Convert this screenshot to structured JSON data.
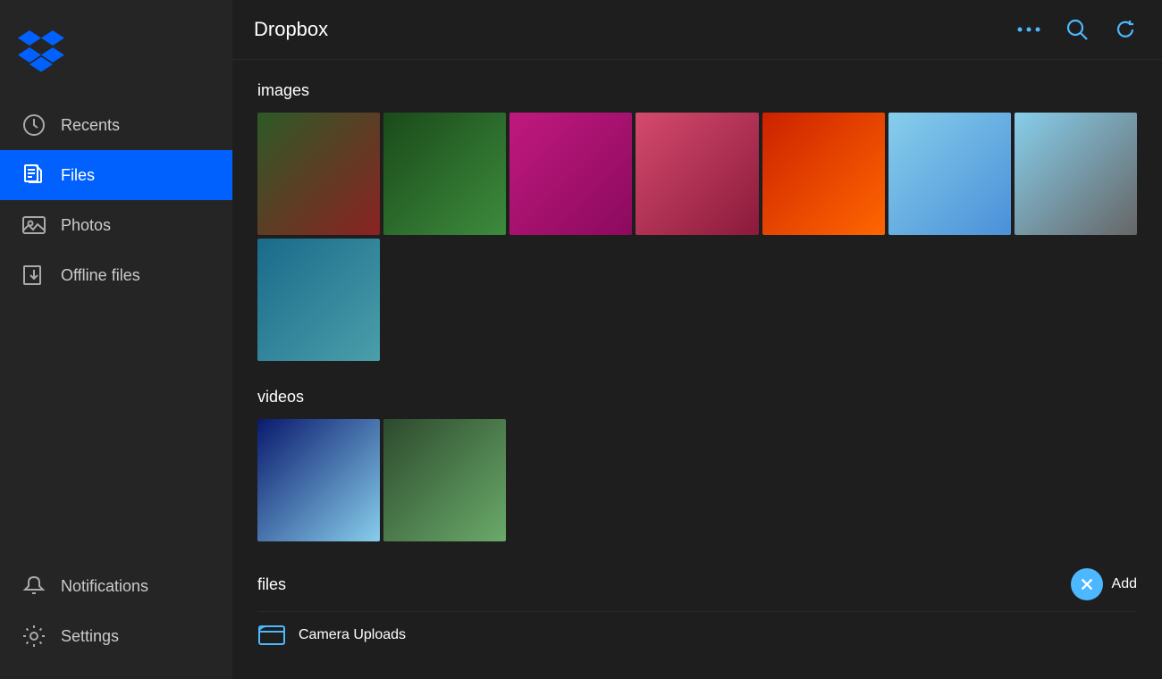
{
  "app": {
    "title": "Dropbox"
  },
  "sidebar": {
    "items": [
      {
        "id": "recents",
        "label": "Recents",
        "active": false
      },
      {
        "id": "files",
        "label": "Files",
        "active": true
      },
      {
        "id": "photos",
        "label": "Photos",
        "active": false
      },
      {
        "id": "offline",
        "label": "Offline files",
        "active": false
      }
    ],
    "bottom_items": [
      {
        "id": "notifications",
        "label": "Notifications"
      },
      {
        "id": "settings",
        "label": "Settings"
      }
    ]
  },
  "main": {
    "header": "Dropbox",
    "sections": [
      {
        "id": "images",
        "title": "images"
      },
      {
        "id": "videos",
        "title": "videos"
      },
      {
        "id": "files",
        "title": "files"
      }
    ],
    "add_button_label": "Add",
    "add_icon": "✕",
    "file_item": "Camera Uploads"
  },
  "topbar_actions": {
    "more": "...",
    "search_icon": "search",
    "refresh_icon": "refresh"
  },
  "colors": {
    "active_nav": "#0061ff",
    "accent": "#4db8ff",
    "bg": "#1e1e1e",
    "sidebar_bg": "#252525"
  }
}
